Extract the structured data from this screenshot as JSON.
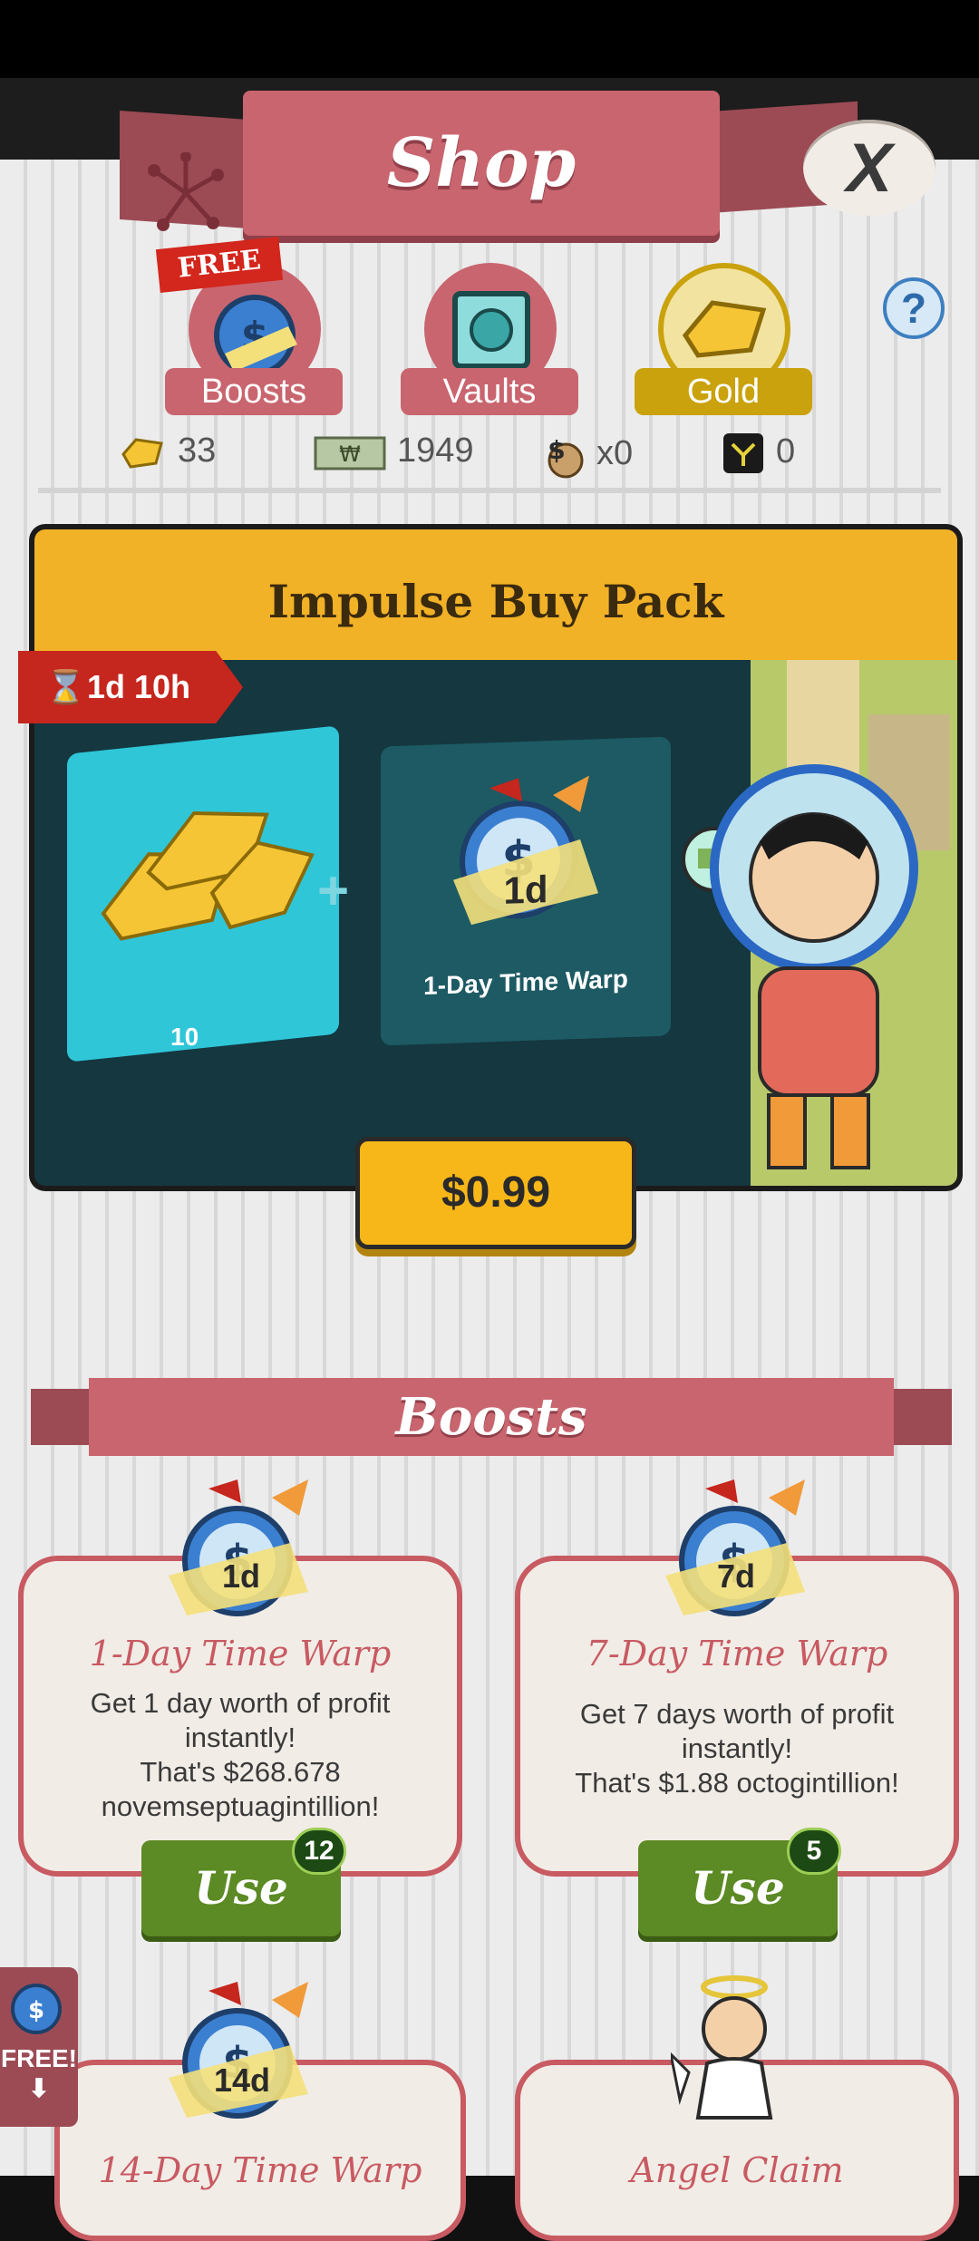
{
  "header": {
    "title": "Shop",
    "close_label": "X"
  },
  "categories": [
    {
      "label": "Boosts",
      "badge": "FREE",
      "color": "#c9656f"
    },
    {
      "label": "Vaults",
      "color": "#c9656f"
    },
    {
      "label": "Gold",
      "color": "#c9a20d"
    }
  ],
  "help_label": "?",
  "currencies": [
    {
      "icon": "gold-icon",
      "value": "33"
    },
    {
      "icon": "cash-icon",
      "value": "1949"
    },
    {
      "icon": "money-bag-icon",
      "value": "x0"
    },
    {
      "icon": "mega-ticket-icon",
      "value": "0"
    }
  ],
  "pack": {
    "title": "Impulse Buy Pack",
    "timer": "1d 10h",
    "gold_qty": "10",
    "plus": "+",
    "warp_badge": "1d",
    "warp_label": "1-Day Time Warp",
    "price": "$0.99"
  },
  "boosts": {
    "title": "Boosts",
    "cards": [
      {
        "badge": "1d",
        "title": "1-Day Time Warp",
        "desc": [
          "Get 1 day worth of profit",
          "instantly!",
          "That's $268.678",
          "novemseptuagintillion!"
        ],
        "use": "Use",
        "count": "12"
      },
      {
        "badge": "7d",
        "title": "7-Day Time Warp",
        "desc": [
          "Get 7 days worth of profit",
          "instantly!",
          "That's $1.88 octogintillion!"
        ],
        "use": "Use",
        "count": "5"
      },
      {
        "badge": "14d",
        "title": "14-Day Time Warp"
      },
      {
        "title": "Angel Claim"
      }
    ]
  },
  "free_tab": {
    "label": "FREE!",
    "arrow": "⬇"
  },
  "colors": {
    "accent_red": "#c9656f",
    "gold": "#f2b227",
    "green": "#5c8a24"
  }
}
